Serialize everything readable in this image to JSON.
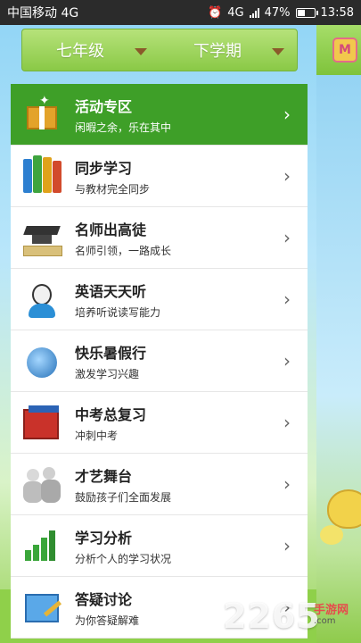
{
  "status_bar": {
    "carrier": "中国移动 4G",
    "network_label": "4G",
    "battery": "47%",
    "battery_level": 0.47,
    "time": "13:58"
  },
  "grade_selector": {
    "grade": "七年级",
    "term": "下学期"
  },
  "menu": [
    {
      "title": "活动专区",
      "subtitle": "闲暇之余，乐在其中",
      "icon": "gift-icon",
      "active": true
    },
    {
      "title": "同步学习",
      "subtitle": "与教材完全同步",
      "icon": "books-icon",
      "active": false
    },
    {
      "title": "名师出高徒",
      "subtitle": "名师引领，一路成长",
      "icon": "graduation-cap-icon",
      "active": false
    },
    {
      "title": "英语天天听",
      "subtitle": "培养听说读写能力",
      "icon": "headset-person-icon",
      "active": false
    },
    {
      "title": "快乐暑假行",
      "subtitle": "激发学习兴趣",
      "icon": "globe-icon",
      "active": false
    },
    {
      "title": "中考总复习",
      "subtitle": "冲刺中考",
      "icon": "book-stack-icon",
      "active": false
    },
    {
      "title": "才艺舞台",
      "subtitle": "鼓励孩子们全面发展",
      "icon": "people-icon",
      "active": false
    },
    {
      "title": "学习分析",
      "subtitle": "分析个人的学习状况",
      "icon": "bar-chart-icon",
      "active": false
    },
    {
      "title": "答疑讨论",
      "subtitle": "为你答疑解难",
      "icon": "chalkboard-icon",
      "active": false
    }
  ],
  "watermark": {
    "brand": "2265",
    "text": "手游网",
    "url": ".com"
  },
  "colors": {
    "active_row": "#3e9f28",
    "grade_bar": "#9cd45a",
    "status_bar": "#2b2b2b"
  }
}
